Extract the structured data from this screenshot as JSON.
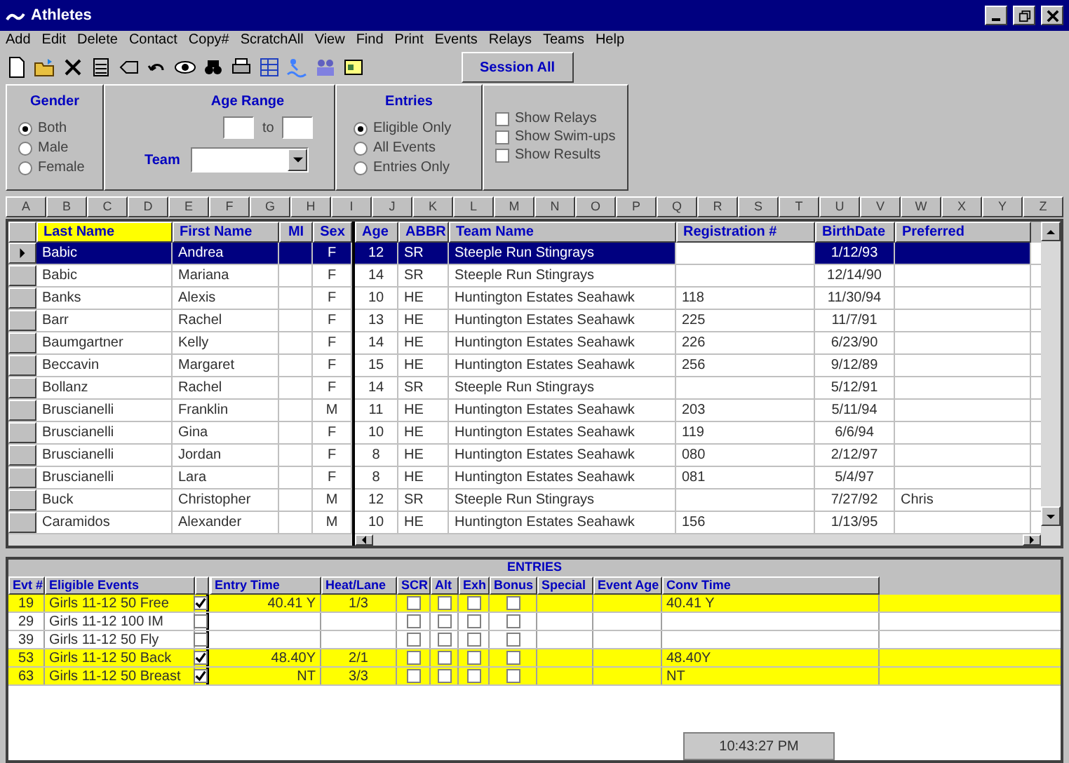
{
  "window": {
    "title": "Athletes"
  },
  "menu": [
    "Add",
    "Edit",
    "Delete",
    "Contact",
    "Copy#",
    "ScratchAll",
    "View",
    "Find",
    "Print",
    "Events",
    "Relays",
    "Teams",
    "Help"
  ],
  "session_button": "Session All",
  "gender": {
    "label": "Gender",
    "options": [
      {
        "label": "Both",
        "selected": true
      },
      {
        "label": "Male",
        "selected": false
      },
      {
        "label": "Female",
        "selected": false
      }
    ]
  },
  "age_range": {
    "label": "Age Range",
    "separator": "to"
  },
  "team": {
    "label": "Team"
  },
  "entries_filter": {
    "label": "Entries",
    "options": [
      {
        "label": "Eligible Only",
        "selected": true
      },
      {
        "label": "All Events",
        "selected": false
      },
      {
        "label": "Entries Only",
        "selected": false
      }
    ]
  },
  "show_options": [
    {
      "label": "Show Relays",
      "checked": false
    },
    {
      "label": "Show Swim-ups",
      "checked": false
    },
    {
      "label": "Show Results",
      "checked": false
    }
  ],
  "letters": [
    "A",
    "B",
    "C",
    "D",
    "E",
    "F",
    "G",
    "H",
    "I",
    "J",
    "K",
    "L",
    "M",
    "N",
    "O",
    "P",
    "Q",
    "R",
    "S",
    "T",
    "U",
    "V",
    "W",
    "X",
    "Y",
    "Z"
  ],
  "athletes": {
    "columns": [
      {
        "label": "Last Name",
        "selected": true
      },
      {
        "label": "First Name",
        "selected": false
      },
      {
        "label": "MI",
        "selected": false
      },
      {
        "label": "Sex",
        "selected": false
      },
      {
        "label": "Age",
        "selected": false
      },
      {
        "label": "ABBR",
        "selected": false
      },
      {
        "label": "Team Name",
        "selected": false
      },
      {
        "label": "Registration #",
        "selected": false
      },
      {
        "label": "BirthDate",
        "selected": false
      },
      {
        "label": "Preferred",
        "selected": false
      }
    ],
    "rows": [
      {
        "selected": true,
        "cells": [
          "Babic",
          "Andrea",
          "",
          "F",
          "12",
          "SR",
          "Steeple Run Stingrays",
          "",
          "1/12/93",
          ""
        ]
      },
      {
        "selected": false,
        "cells": [
          "Babic",
          "Mariana",
          "",
          "F",
          "14",
          "SR",
          "Steeple Run Stingrays",
          "",
          "12/14/90",
          ""
        ]
      },
      {
        "selected": false,
        "cells": [
          "Banks",
          "Alexis",
          "",
          "F",
          "10",
          "HE",
          "Huntington Estates Seahawk",
          "118",
          "11/30/94",
          ""
        ]
      },
      {
        "selected": false,
        "cells": [
          "Barr",
          "Rachel",
          "",
          "F",
          "13",
          "HE",
          "Huntington Estates Seahawk",
          "225",
          "11/7/91",
          ""
        ]
      },
      {
        "selected": false,
        "cells": [
          "Baumgartner",
          "Kelly",
          "",
          "F",
          "14",
          "HE",
          "Huntington Estates Seahawk",
          "226",
          "6/23/90",
          ""
        ]
      },
      {
        "selected": false,
        "cells": [
          "Beccavin",
          "Margaret",
          "",
          "F",
          "15",
          "HE",
          "Huntington Estates Seahawk",
          "256",
          "9/12/89",
          ""
        ]
      },
      {
        "selected": false,
        "cells": [
          "Bollanz",
          "Rachel",
          "",
          "F",
          "14",
          "SR",
          "Steeple Run Stingrays",
          "",
          "5/12/91",
          ""
        ]
      },
      {
        "selected": false,
        "cells": [
          "Bruscianelli",
          "Franklin",
          "",
          "M",
          "11",
          "HE",
          "Huntington Estates Seahawk",
          "203",
          "5/11/94",
          ""
        ]
      },
      {
        "selected": false,
        "cells": [
          "Bruscianelli",
          "Gina",
          "",
          "F",
          "10",
          "HE",
          "Huntington Estates Seahawk",
          "119",
          "6/6/94",
          ""
        ]
      },
      {
        "selected": false,
        "cells": [
          "Bruscianelli",
          "Jordan",
          "",
          "F",
          "8",
          "HE",
          "Huntington Estates Seahawk",
          "080",
          "2/12/97",
          ""
        ]
      },
      {
        "selected": false,
        "cells": [
          "Bruscianelli",
          "Lara",
          "",
          "F",
          "8",
          "HE",
          "Huntington Estates Seahawk",
          "081",
          "5/4/97",
          ""
        ]
      },
      {
        "selected": false,
        "cells": [
          "Buck",
          "Christopher",
          "",
          "M",
          "12",
          "SR",
          "Steeple Run Stingrays",
          "",
          "7/27/92",
          "Chris"
        ]
      },
      {
        "selected": false,
        "cells": [
          "Caramidos",
          "Alexander",
          "",
          "M",
          "10",
          "HE",
          "Huntington Estates Seahawk",
          "156",
          "1/13/95",
          ""
        ]
      }
    ]
  },
  "entries": {
    "title": "ENTRIES",
    "columns": [
      "Evt #",
      "Eligible Events",
      "",
      "Entry Time",
      "Heat/Lane",
      "SCR",
      "Alt",
      "Exh",
      "Bonus",
      "Special",
      "Event Age",
      "Conv Time"
    ],
    "rows": [
      {
        "evt": "19",
        "event": "Girls 11-12 50 Free",
        "entered": true,
        "entry_time": "40.41 Y",
        "heat_lane": "1/3",
        "scr": false,
        "alt": false,
        "exh": false,
        "bonus": false,
        "conv_time": "40.41 Y"
      },
      {
        "evt": "29",
        "event": "Girls 11-12 100 IM",
        "entered": false,
        "scr": false,
        "alt": false,
        "exh": false,
        "bonus": false
      },
      {
        "evt": "39",
        "event": "Girls 11-12 50 Fly",
        "entered": false,
        "scr": false,
        "alt": false,
        "exh": false,
        "bonus": false
      },
      {
        "evt": "53",
        "event": "Girls 11-12 50 Back",
        "entered": true,
        "entry_time": "48.40Y",
        "heat_lane": "2/1",
        "scr": false,
        "alt": false,
        "exh": false,
        "bonus": false,
        "conv_time": "48.40Y"
      },
      {
        "evt": "63",
        "event": "Girls 11-12 50 Breast",
        "entered": true,
        "entry_time": "NT",
        "heat_lane": "3/3",
        "scr": false,
        "alt": false,
        "exh": false,
        "bonus": false,
        "conv_time": "NT"
      }
    ]
  },
  "clock": "10:43:27 PM"
}
